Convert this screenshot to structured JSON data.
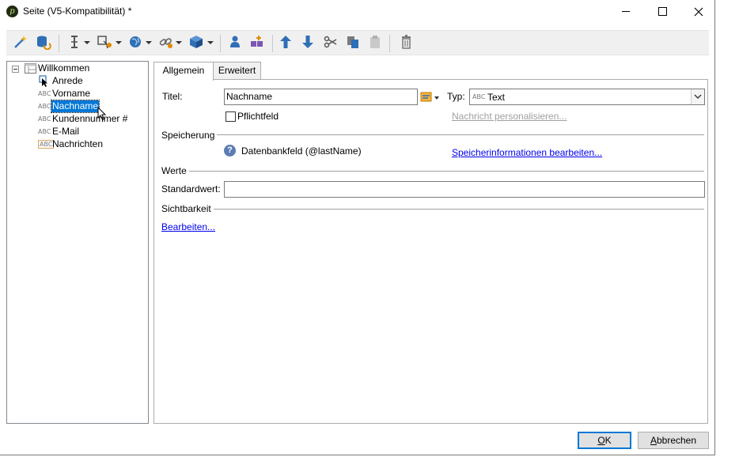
{
  "window": {
    "title": "Seite (V5-Kompatibilität) *",
    "app_icon_glyph": "p",
    "accent_color": "#0078d7"
  },
  "toolbar": {
    "icons": [
      "wizard-icon",
      "database-refresh-icon",
      "insert-field-icon",
      "add-control-icon",
      "globe-icon",
      "link-icon",
      "package-icon",
      "person-icon",
      "group-add-icon",
      "move-up-icon",
      "move-down-icon",
      "cut-icon",
      "copy-icon",
      "paste-icon",
      "delete-icon"
    ]
  },
  "tree": {
    "root": "Willkommen",
    "items": [
      {
        "label": "Anrede",
        "icon": "cursor-icon"
      },
      {
        "label": "Vorname",
        "icon": "abc-icon"
      },
      {
        "label": "Nachname",
        "icon": "abc-icon",
        "selected": true
      },
      {
        "label": "Kundennummer #",
        "icon": "abc-icon"
      },
      {
        "label": "E-Mail",
        "icon": "abc-icon"
      },
      {
        "label": "Nachrichten",
        "icon": "abc-box-icon"
      }
    ],
    "abc_text": "ABC"
  },
  "tabs": [
    {
      "label": "Allgemein",
      "active": true
    },
    {
      "label": "Erweitert",
      "active": false
    }
  ],
  "general": {
    "title_label": "Titel:",
    "title_value": "Nachname",
    "type_label": "Typ:",
    "type_abc": "ABC",
    "type_value": "Text",
    "mandatory_label": "Pflichtfeld",
    "mandatory_checked": false,
    "personalize_link": "Nachricht personalisieren...",
    "storage_header": "Speicherung",
    "storage_help": "?",
    "storage_field": "Datenbankfeld (@lastName)",
    "storage_edit_link": "Speicherinformationen bearbeiten...",
    "values_header": "Werte",
    "default_label": "Standardwert:",
    "default_value": "",
    "visibility_header": "Sichtbarkeit",
    "visibility_edit_link": "Bearbeiten..."
  },
  "footer": {
    "ok_label": "OK",
    "ok_mnemonic": "O",
    "ok_rest": "K",
    "cancel_mnemonic": "A",
    "cancel_rest": "bbrechen"
  }
}
